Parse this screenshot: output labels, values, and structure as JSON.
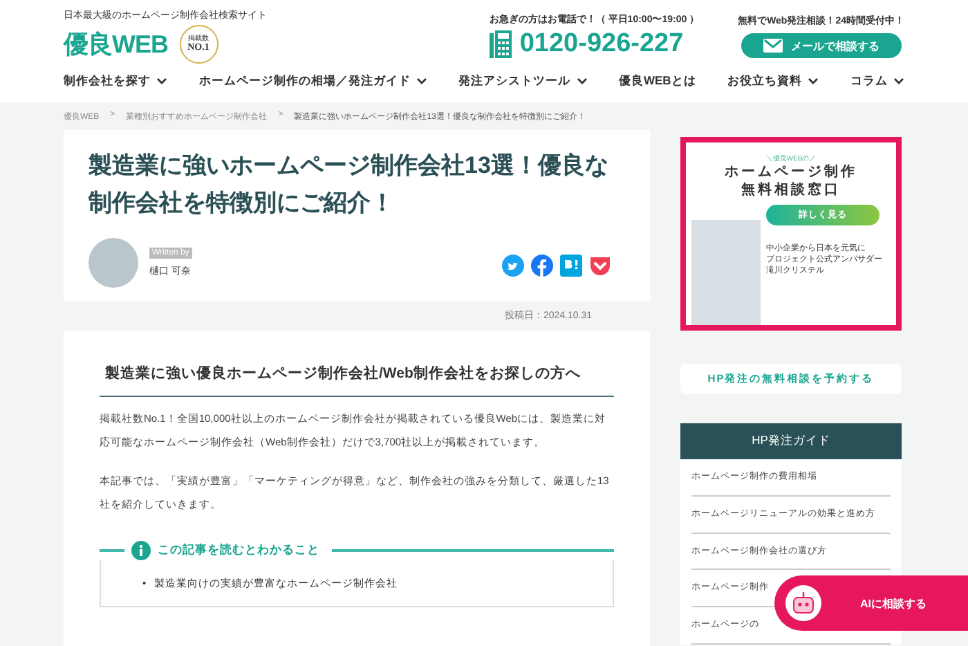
{
  "header": {
    "tagline": "日本最大級のホームページ制作会社検索サイト",
    "logo": "優良WEB",
    "badge_top": "掲載数",
    "badge_main": "NO.1",
    "phone_note": "お急ぎの方はお電話で！（ 平日10:00〜19:00 ）",
    "phone": "0120-926-227",
    "mail_note": "無料でWeb発注相談！24時間受付中！",
    "mail_button": "メールで相談する"
  },
  "nav": [
    {
      "label": "制作会社を探す",
      "dropdown": true
    },
    {
      "label": "ホームページ制作の相場／発注ガイド",
      "dropdown": true
    },
    {
      "label": "発注アシストツール",
      "dropdown": true
    },
    {
      "label": "優良WEBとは",
      "dropdown": false
    },
    {
      "label": "お役立ち資料",
      "dropdown": true
    },
    {
      "label": "コラム",
      "dropdown": true
    }
  ],
  "breadcrumb": [
    {
      "label": "優良WEB",
      "current": false
    },
    {
      "separator": ">",
      "label": "業種別おすすめホームページ制作会社",
      "current": false
    },
    {
      "separator": ">",
      "label": "製造業に強いホームページ制作会社13選！優良な制作会社を特徴別にご紹介！",
      "current": true
    }
  ],
  "article": {
    "title": "製造業に強いホームページ制作会社13選！優良な制作会社を特徴別にご紹介！",
    "written_by": "Written by",
    "author": "樋口 可奈",
    "date": "投稿日：2024.10.31",
    "heading": "製造業に強い優良ホームページ制作会社/Web制作会社をお探しの方へ",
    "paragraphs": [
      "掲載社数No.1！全国10,000社以上のホームページ制作会社が掲載されている優良Webには、製造業に対応可能なホームページ制作会社（Web制作会社）だけで3,700社以上が掲載されています。",
      "本記事では、「実績が豊富」「マーケティングが得意」など、制作会社の強みを分類して、厳選した13社を紹介していきます。"
    ],
    "summary_title": "この記事を読むとわかること",
    "summary_items": [
      {
        "bullet": "•",
        "text": "製造業向けの実績が豊富なホームページ制作会社"
      }
    ]
  },
  "sidebar": {
    "banner": {
      "kicker": "＼優良WEBの／",
      "title_lines": [
        "ホームページ制作",
        "無料相談窓口"
      ],
      "button": "詳しく見る",
      "caption_lines": [
        "中小企業から日本を元気に",
        "プロジェクト公式アンバサダー",
        "滝川クリステル"
      ]
    },
    "reserve_button": "HP発注の無料相談を予約する",
    "guide_title": "HP発注ガイド",
    "guide_items": [
      "ホームページ制作の費用相場",
      "ホームページリニューアルの効果と進め方",
      "ホームページ制作会社の選び方",
      "ホームページ制作",
      "ホームページの"
    ]
  },
  "ai_button": "AIに相談する"
}
